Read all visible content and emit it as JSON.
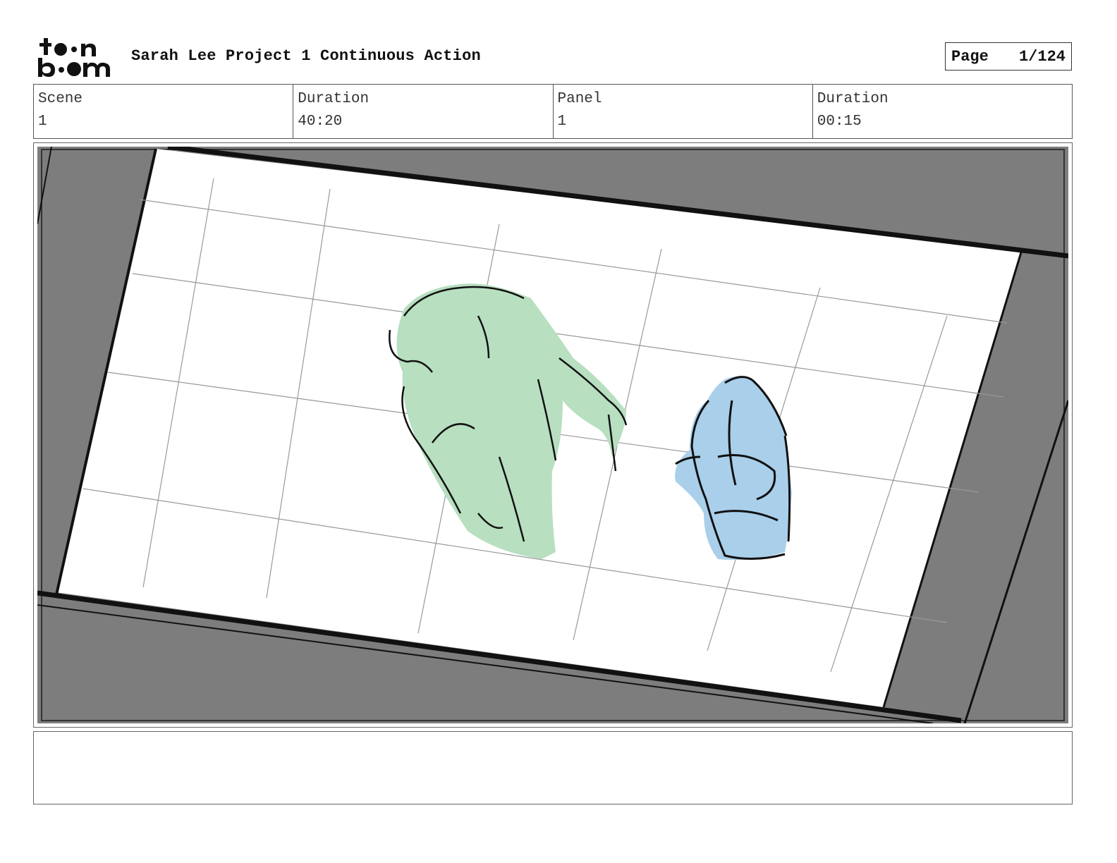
{
  "header": {
    "logo": {
      "line1": "toon",
      "line2": "boom"
    },
    "title": "Sarah Lee Project 1 Continuous Action",
    "page_label": "Page",
    "page_value": "1/124"
  },
  "info": {
    "scene_label": "Scene",
    "scene_value": "1",
    "scene_duration_label": "Duration",
    "scene_duration_value": "40:20",
    "panel_label": "Panel",
    "panel_value": "1",
    "panel_duration_label": "Duration",
    "panel_duration_value": "00:15"
  },
  "panel": {
    "frame_color": "#7d7d7d",
    "floor_color": "#ffffff",
    "figure_left_color": "#b7dfc0",
    "figure_right_color": "#a9cfea",
    "line_color": "#111111"
  },
  "notes": {
    "text": ""
  }
}
